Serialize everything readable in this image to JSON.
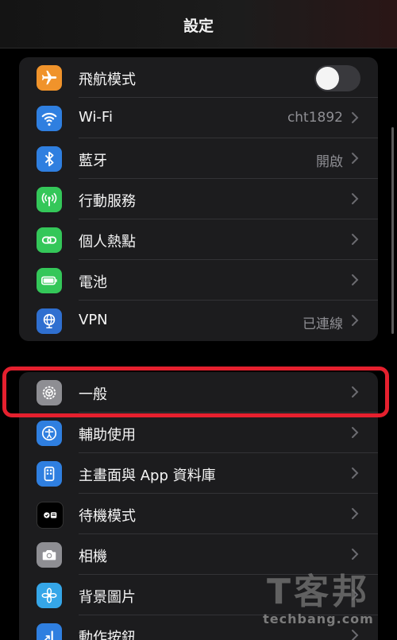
{
  "header": {
    "title": "設定"
  },
  "group1": {
    "rows": [
      {
        "label": "飛航模式",
        "icon": "airplane-icon",
        "color": "#f0932b",
        "toggle": false
      },
      {
        "label": "Wi-Fi",
        "icon": "wifi-icon",
        "color": "#2f7fe0",
        "value": "cht1892"
      },
      {
        "label": "藍牙",
        "icon": "bluetooth-icon",
        "color": "#2f7fe0",
        "value": "開啟"
      },
      {
        "label": "行動服務",
        "icon": "antenna-icon",
        "color": "#34c759"
      },
      {
        "label": "個人熱點",
        "icon": "link-icon",
        "color": "#34c759"
      },
      {
        "label": "電池",
        "icon": "battery-icon",
        "color": "#34c759"
      },
      {
        "label": "VPN",
        "icon": "globe-icon",
        "color": "#2f6fd0",
        "value": "已連線"
      }
    ]
  },
  "group2": {
    "rows": [
      {
        "label": "一般",
        "icon": "gear-icon",
        "color": "#8e8e93"
      },
      {
        "label": "輔助使用",
        "icon": "accessibility-icon",
        "color": "#2f7fe0"
      },
      {
        "label": "主畫面與 App 資料庫",
        "icon": "home-screen-icon",
        "color": "#2f7fe0"
      },
      {
        "label": "待機模式",
        "icon": "standby-icon",
        "color": "#000000"
      },
      {
        "label": "相機",
        "icon": "camera-icon",
        "color": "#8e8e93"
      },
      {
        "label": "背景圖片",
        "icon": "flower-icon",
        "color": "#35a6e8"
      },
      {
        "label": "動作按鈕",
        "icon": "action-button-icon",
        "color": "#2f7fe0"
      }
    ]
  },
  "watermark": {
    "title": "T客邦",
    "url": "techbang.com"
  }
}
